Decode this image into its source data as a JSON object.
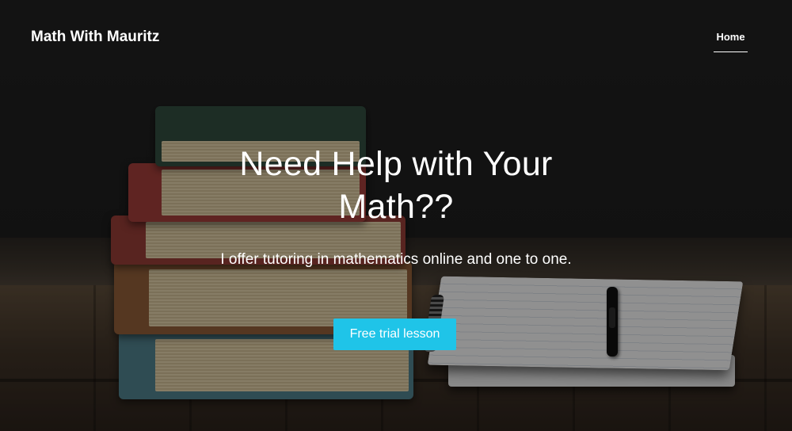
{
  "header": {
    "site_title": "Math With Mauritz",
    "nav": [
      {
        "label": "Home",
        "active": true
      }
    ]
  },
  "hero": {
    "heading": "Need Help with Your Math??",
    "subheading": "I offer tutoring in mathematics online and one to one.",
    "cta_label": "Free trial lesson",
    "cta_color": "#1fc4e8",
    "background": "dark photo of a stack of old books beside a spiral notebook and pen on a wooden table"
  }
}
